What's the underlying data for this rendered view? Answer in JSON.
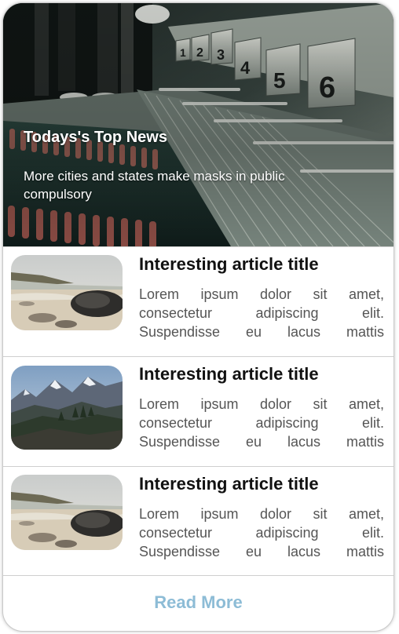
{
  "hero": {
    "title": "Todays's Top News",
    "subtitle": "More cities and states make masks in public compulsory",
    "image": "swimming-pool-starting-blocks-photo",
    "block_numbers": [
      "1",
      "2",
      "3",
      "4",
      "5",
      "6"
    ]
  },
  "articles": [
    {
      "title": "Interesting article title",
      "body": "Lorem ipsum dolor sit amet, consectetur adipiscing elit. Suspendisse eu lacus mattis",
      "image": "beach-rocks-photo"
    },
    {
      "title": "Interesting article title",
      "body": "Lorem ipsum dolor sit amet, consectetur adipiscing elit. Suspendisse eu lacus mattis",
      "image": "mountains-photo"
    },
    {
      "title": "Interesting article title",
      "body": "Lorem ipsum dolor sit amet, consectetur adipiscing elit. Suspendisse eu lacus mattis",
      "image": "beach-rocks-photo"
    }
  ],
  "footer": {
    "read_more_label": "Read More"
  },
  "colors": {
    "read_more": "#8dbcd6",
    "title_text": "#111111",
    "body_text": "#555555",
    "divider": "#cfcfcf"
  }
}
